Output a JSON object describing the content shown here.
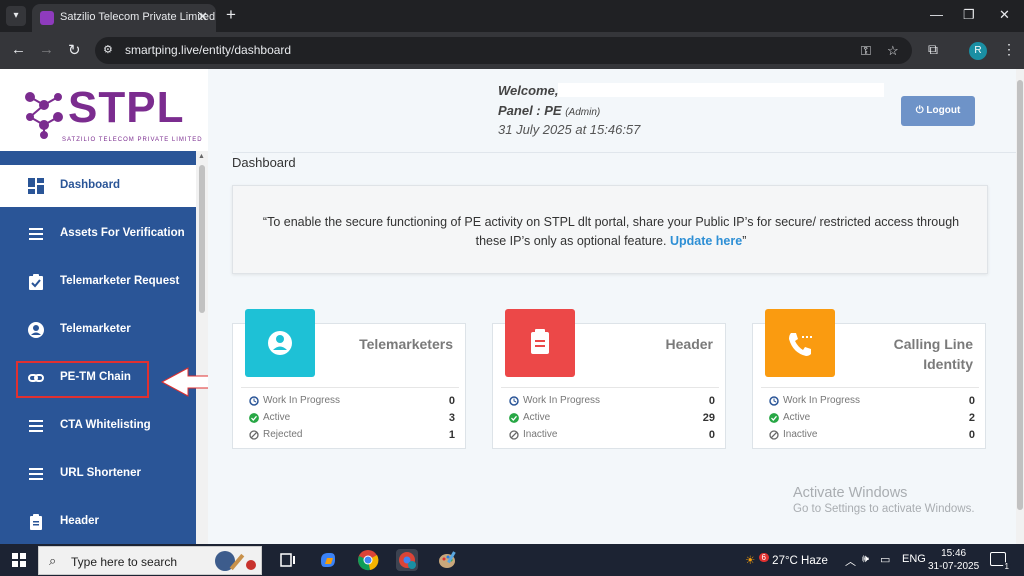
{
  "browser": {
    "tab_title": "Satzilio Telecom Private Limited",
    "url": "smartping.live/entity/dashboard",
    "profile_initial": "R"
  },
  "logo": {
    "text": "STPL",
    "subtitle": "SATZILIO TELECOM PRIVATE LIMITED"
  },
  "sidebar": {
    "items": [
      {
        "label": "Dashboard",
        "icon": "dashboard-icon"
      },
      {
        "label": "Assets For Verification",
        "icon": "list-icon"
      },
      {
        "label": "Telemarketer Request",
        "icon": "clipboard-check-icon"
      },
      {
        "label": "Telemarketer",
        "icon": "user-circle-icon"
      },
      {
        "label": "PE-TM Chain",
        "icon": "link-icon"
      },
      {
        "label": "CTA Whitelisting",
        "icon": "list-icon"
      },
      {
        "label": "URL Shortener",
        "icon": "list-icon"
      },
      {
        "label": "Header",
        "icon": "clipboard-icon"
      }
    ]
  },
  "header": {
    "welcome": "Welcome,",
    "panel_label": "Panel : PE",
    "panel_role": "(Admin)",
    "datetime": "31 July 2025 at 15:46:57",
    "logout_label": "Logout"
  },
  "main": {
    "title": "Dashboard",
    "notice_text": "“To enable the secure functioning of PE activity on STPL dlt portal, share your Public IP’s for secure/ restricted access through these IP’s only as optional feature. ",
    "notice_link": "Update here",
    "notice_end": "”"
  },
  "cards": [
    {
      "title_line1": "Telemarketers",
      "title_line2": "",
      "color": "#1ec1d6",
      "stats": [
        {
          "label": "Work In Progress",
          "value": "0"
        },
        {
          "label": "Active",
          "value": "3"
        },
        {
          "label": "Rejected",
          "value": "1"
        }
      ]
    },
    {
      "title_line1": "Header",
      "title_line2": "",
      "color": "#ec4848",
      "stats": [
        {
          "label": "Work In Progress",
          "value": "0"
        },
        {
          "label": "Active",
          "value": "29"
        },
        {
          "label": "Inactive",
          "value": "0"
        }
      ]
    },
    {
      "title_line1": "Calling Line",
      "title_line2": "Identity",
      "color": "#fa9b10",
      "stats": [
        {
          "label": "Work In Progress",
          "value": "0"
        },
        {
          "label": "Active",
          "value": "2"
        },
        {
          "label": "Inactive",
          "value": "0"
        }
      ]
    }
  ],
  "watermark": {
    "line1": "Activate Windows",
    "line2": "Go to Settings to activate Windows."
  },
  "taskbar": {
    "search_placeholder": "Type here to search",
    "weather_badge": "6",
    "weather": "27°C  Haze",
    "lang": "ENG",
    "time": "15:46",
    "date": "31-07-2025",
    "notification_count": "1"
  }
}
